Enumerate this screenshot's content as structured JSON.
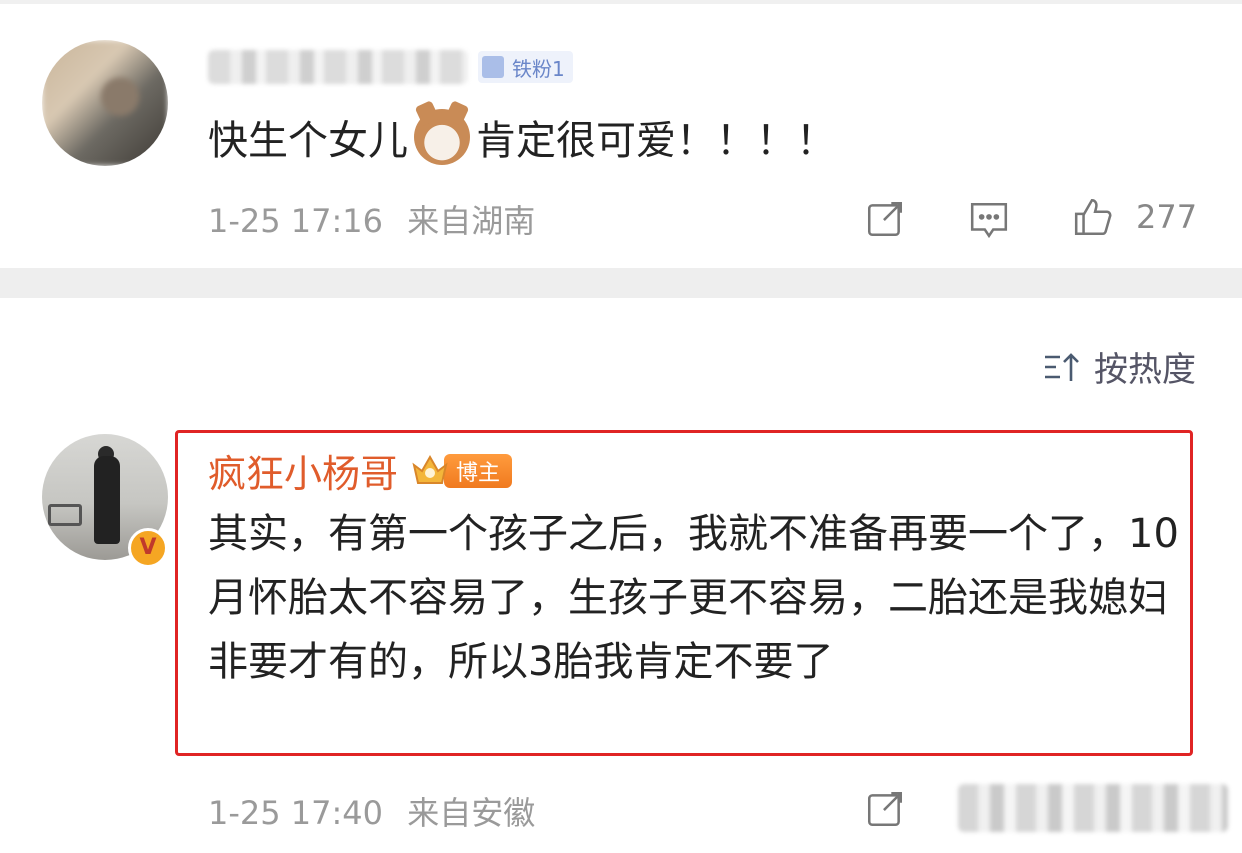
{
  "comments": [
    {
      "fan_badge": "铁粉1",
      "text_before": "快生个女儿",
      "emoji": "cat-emoji",
      "text_after": "肯定很可爱！！！！",
      "time": "1-25 17:16",
      "location": "来自湖南",
      "likes": "277"
    },
    {
      "username": "疯狂小杨哥",
      "role_badge": "博主",
      "verified": "V",
      "text": "其实，有第一个孩子之后，我就不准备再要一个了，10月怀胎太不容易了，生孩子更不容易，二胎还是我媳妇非要才有的，所以3胎我肯定不要了",
      "time": "1-25 17:40",
      "location": "来自安徽"
    }
  ],
  "sort": {
    "label": "按热度",
    "icon": "sort-icon"
  },
  "colors": {
    "author": "#e05c2b",
    "highlight": "#e02424",
    "meta": "#9a9a9a"
  }
}
